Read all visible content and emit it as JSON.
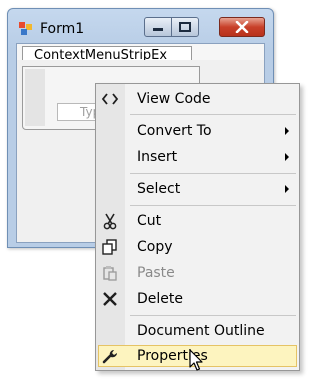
{
  "form": {
    "title": "Form1",
    "menu_strip_label": "ContextMenuStripEx",
    "type_here_placeholder": "Typ"
  },
  "context_menu": {
    "items": [
      {
        "label": "View Code",
        "icon": "code-icon",
        "enabled": true,
        "submenu": false
      },
      {
        "label": "Convert To",
        "icon": null,
        "enabled": true,
        "submenu": true
      },
      {
        "label": "Insert",
        "icon": null,
        "enabled": true,
        "submenu": true
      },
      {
        "label": "Select",
        "icon": null,
        "enabled": true,
        "submenu": true
      },
      {
        "label": "Cut",
        "icon": "scissors-icon",
        "enabled": true,
        "submenu": false
      },
      {
        "label": "Copy",
        "icon": "copy-icon",
        "enabled": true,
        "submenu": false
      },
      {
        "label": "Paste",
        "icon": "paste-icon",
        "enabled": false,
        "submenu": false
      },
      {
        "label": "Delete",
        "icon": "delete-x-icon",
        "enabled": true,
        "submenu": false
      },
      {
        "label": "Document Outline",
        "icon": null,
        "enabled": true,
        "submenu": false
      },
      {
        "label": "Properties",
        "icon": "wrench-icon",
        "enabled": true,
        "submenu": false,
        "highlighted": true
      }
    ]
  },
  "colors": {
    "highlight_background": "#fdf4bf",
    "highlight_border": "#e5c365",
    "close_button": "#c8402a",
    "disabled_text": "#8a8a8a"
  }
}
